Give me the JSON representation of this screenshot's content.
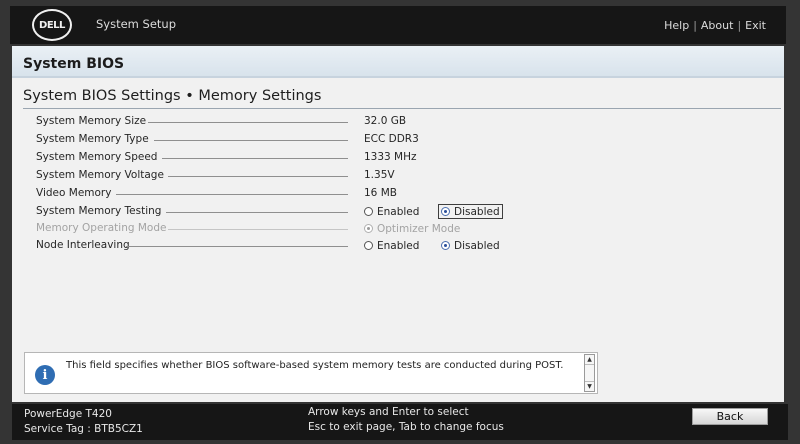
{
  "header": {
    "logo_text": "DELL",
    "app_title": "System Setup",
    "links": [
      "Help",
      "About",
      "Exit"
    ],
    "separator": "|"
  },
  "section": {
    "title": "System BIOS"
  },
  "page": {
    "title": "System BIOS Settings • Memory Settings"
  },
  "settings": {
    "memory_size": {
      "label": "System Memory Size",
      "value": "32.0 GB"
    },
    "memory_type": {
      "label": "System Memory Type",
      "value": "ECC DDR3"
    },
    "memory_speed": {
      "label": "System Memory Speed",
      "value": "1333 MHz"
    },
    "memory_voltage": {
      "label": "System Memory Voltage",
      "value": "1.35V"
    },
    "video_memory": {
      "label": "Video Memory",
      "value": "16 MB"
    },
    "memory_testing": {
      "label": "System Memory Testing",
      "options": [
        "Enabled",
        "Disabled"
      ],
      "selected": "Disabled"
    },
    "operating_mode": {
      "label": "Memory Operating Mode",
      "options": [
        "Optimizer Mode"
      ],
      "selected": "Optimizer Mode",
      "enabled": false
    },
    "node_interleaving": {
      "label": "Node Interleaving",
      "options": [
        "Enabled",
        "Disabled"
      ],
      "selected": "Disabled"
    }
  },
  "help": {
    "icon": "info-icon",
    "text": "This field specifies whether BIOS software-based system memory tests are conducted during POST."
  },
  "footer": {
    "model": "PowerEdge T420",
    "service_tag": "Service Tag : BTB5CZ1",
    "key_help_1": "Arrow keys and Enter to select",
    "key_help_2": "Esc to exit page, Tab to change focus",
    "back_label": "Back"
  },
  "colors": {
    "bar_background": "#161616",
    "header_band": "#d8e3ec",
    "info_icon": "#2f6db3",
    "radio_selected": "#2b4f9a"
  }
}
